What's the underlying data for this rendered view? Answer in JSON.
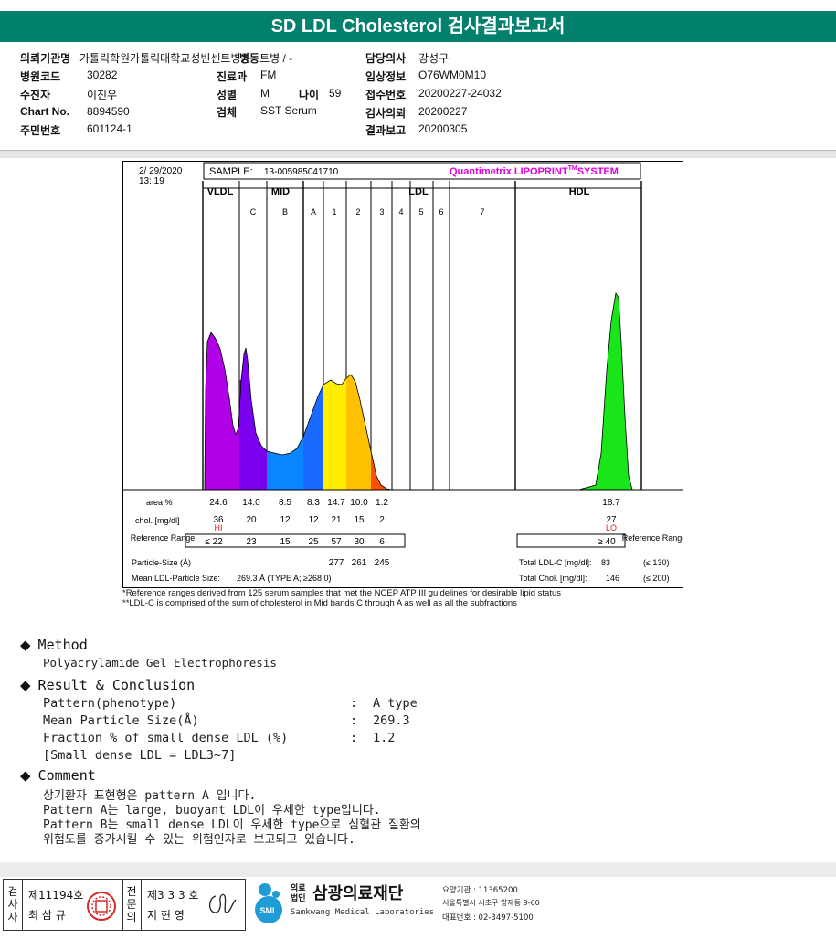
{
  "report": {
    "title": "SD LDL Cholesterol 검사결과보고서"
  },
  "patient": {
    "institution_label": "의뢰기관명",
    "institution": "가톨릭학원가톨릭대학교성빈센트병원",
    "hospital_code_label": "병원코드",
    "hospital_code": "30282",
    "recipient_label": "수진자",
    "recipient": "이진우",
    "chart_no_label": "Chart No.",
    "chart_no": "8894590",
    "id_no_label": "주민번호",
    "id_no": "601124-1",
    "ward_label": "병동",
    "ward": "트병 / -",
    "dept_label": "진료과",
    "dept": "FM",
    "sex_label": "성별",
    "sex": "M",
    "age_label": "나이",
    "age": "59",
    "specimen_label": "검체",
    "specimen": "SST Serum",
    "doctor_label": "담당의사",
    "doctor": "강성구",
    "clinical_label": "임상정보",
    "clinical": "O76WM0M10",
    "receipt_label": "접수번호",
    "receipt": "20200227-24032",
    "request_label": "검사의뢰",
    "request": "20200227",
    "result_label": "결과보고",
    "result": "20200305"
  },
  "chart_data": {
    "type": "area",
    "date": "2/ 29/2020",
    "time": "13: 19",
    "sample_label": "SAMPLE:",
    "sample_id": "13-005985041710",
    "system_prefix": "Quantimetrix LIPOPRINT",
    "system_tm": "TM",
    "system_suffix": "SYSTEM",
    "group_labels": [
      "VLDL",
      "MID",
      "LDL",
      "HDL"
    ],
    "band_labels": [
      "C",
      "B",
      "A",
      "1",
      "2",
      "3",
      "4",
      "5",
      "6",
      "7"
    ],
    "fractions": [
      "VLDL",
      "MID C",
      "MID B",
      "MID A",
      "LDL1",
      "LDL2",
      "LDL3",
      "LDL4",
      "LDL5",
      "LDL6",
      "LDL7",
      "HDL"
    ],
    "colors": [
      "#b000e8",
      "#7b00f0",
      "#0a84ff",
      "#1a6aff",
      "#ffee00",
      "#ffc000",
      "#ff5000",
      "#d80030",
      "#b00040",
      "#909090",
      "#909090",
      "#19e619"
    ],
    "row_labels": {
      "area": "area %",
      "chol": "chol. [mg/dl]",
      "ref": "Reference Range",
      "particle": "Particle-Size (Å)",
      "mean": "Mean LDL-Particle Size:"
    },
    "area_pct": [
      "24.6",
      "14.0",
      "8.5",
      "8.3",
      "14.7",
      "10.0",
      "1.2",
      "18.7"
    ],
    "chol_mgdl": [
      "36",
      "20",
      "12",
      "12",
      "21",
      "15",
      "2",
      "27"
    ],
    "flags": {
      "vldl": "HI",
      "hdl": "LO"
    },
    "reference": [
      "≤ 22",
      "23",
      "15",
      "25",
      "57",
      "30",
      "6",
      "≥ 40"
    ],
    "reference_right": "Reference Range",
    "particle_sizes": [
      "277",
      "261",
      "245"
    ],
    "mean_particle": "269.3 Å   (TYPE A; ≥268.0)",
    "total_ldl_label": "Total LDL-C [mg/dl]:",
    "total_ldl": "83",
    "total_ldl_ref": "(≤ 130)",
    "total_chol_label": "Total Chol. [mg/dl]:",
    "total_chol": "146",
    "total_chol_ref": "(≤ 200)"
  },
  "notes": [
    "*Reference ranges derived from 125 serum samples that met the NCEP ATP III guidelines for desirable lipid status",
    "**LDL-C is comprised of the sum of cholesterol in Mid bands C through A as well as all the subfractions"
  ],
  "method": {
    "heading": "Method",
    "text": "Polyacrylamide Gel Electrophoresis"
  },
  "result": {
    "heading": "Result & Conclusion",
    "rows": [
      {
        "label": "Pattern(phenotype)",
        "value": "A type"
      },
      {
        "label": "Mean Particle Size(Å)",
        "value": "269.3"
      },
      {
        "label": "Fraction % of small dense LDL (%)",
        "value": "1.2"
      }
    ],
    "note": "[Small dense LDL = LDL3~7]"
  },
  "comment": {
    "heading": "Comment",
    "lines": [
      "상기환자 표현형은 pattern A 입니다.",
      "Pattern A는 large, buoyant LDL이 우세한 type입니다.",
      "Pattern B는 small dense LDL이 우세한 type으로 심혈관 질환의",
      "위험도를 증가시킬 수 있는 위험인자로 보고되고 있습니다."
    ]
  },
  "footer": {
    "examiner_label": "검사자",
    "examiner_no": "제11194호",
    "examiner_name": "최 삼 규",
    "specialist_label": "전문의",
    "specialist_no": "제3 3 3 호",
    "specialist_name": "지 현 영",
    "logo_text": "SML",
    "org_prefix_1": "의료",
    "org_prefix_2": "법인",
    "org_name": "삼광의료재단",
    "org_english": "Samkwang Medical Laboratories",
    "org_code": "요양기관 : 11365200",
    "org_address": "서울특별시 서초구 양재동 9-60",
    "org_phone": "대표번호 : 02-3497-5100"
  }
}
